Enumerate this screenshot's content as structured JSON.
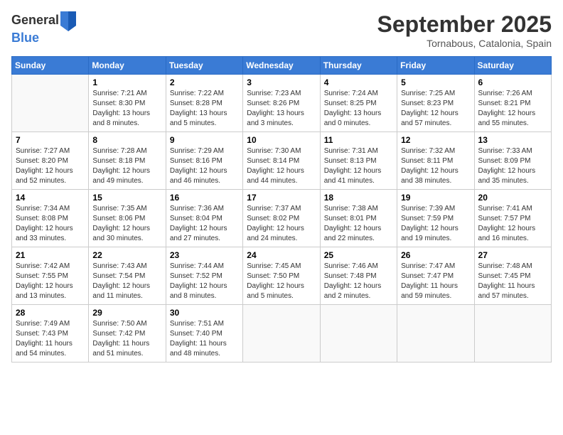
{
  "logo": {
    "general": "General",
    "blue": "Blue"
  },
  "header": {
    "month": "September 2025",
    "location": "Tornabous, Catalonia, Spain"
  },
  "days_of_week": [
    "Sunday",
    "Monday",
    "Tuesday",
    "Wednesday",
    "Thursday",
    "Friday",
    "Saturday"
  ],
  "weeks": [
    [
      {
        "day": "",
        "sunrise": "",
        "sunset": "",
        "daylight": ""
      },
      {
        "day": "1",
        "sunrise": "Sunrise: 7:21 AM",
        "sunset": "Sunset: 8:30 PM",
        "daylight": "Daylight: 13 hours and 8 minutes."
      },
      {
        "day": "2",
        "sunrise": "Sunrise: 7:22 AM",
        "sunset": "Sunset: 8:28 PM",
        "daylight": "Daylight: 13 hours and 5 minutes."
      },
      {
        "day": "3",
        "sunrise": "Sunrise: 7:23 AM",
        "sunset": "Sunset: 8:26 PM",
        "daylight": "Daylight: 13 hours and 3 minutes."
      },
      {
        "day": "4",
        "sunrise": "Sunrise: 7:24 AM",
        "sunset": "Sunset: 8:25 PM",
        "daylight": "Daylight: 13 hours and 0 minutes."
      },
      {
        "day": "5",
        "sunrise": "Sunrise: 7:25 AM",
        "sunset": "Sunset: 8:23 PM",
        "daylight": "Daylight: 12 hours and 57 minutes."
      },
      {
        "day": "6",
        "sunrise": "Sunrise: 7:26 AM",
        "sunset": "Sunset: 8:21 PM",
        "daylight": "Daylight: 12 hours and 55 minutes."
      }
    ],
    [
      {
        "day": "7",
        "sunrise": "Sunrise: 7:27 AM",
        "sunset": "Sunset: 8:20 PM",
        "daylight": "Daylight: 12 hours and 52 minutes."
      },
      {
        "day": "8",
        "sunrise": "Sunrise: 7:28 AM",
        "sunset": "Sunset: 8:18 PM",
        "daylight": "Daylight: 12 hours and 49 minutes."
      },
      {
        "day": "9",
        "sunrise": "Sunrise: 7:29 AM",
        "sunset": "Sunset: 8:16 PM",
        "daylight": "Daylight: 12 hours and 46 minutes."
      },
      {
        "day": "10",
        "sunrise": "Sunrise: 7:30 AM",
        "sunset": "Sunset: 8:14 PM",
        "daylight": "Daylight: 12 hours and 44 minutes."
      },
      {
        "day": "11",
        "sunrise": "Sunrise: 7:31 AM",
        "sunset": "Sunset: 8:13 PM",
        "daylight": "Daylight: 12 hours and 41 minutes."
      },
      {
        "day": "12",
        "sunrise": "Sunrise: 7:32 AM",
        "sunset": "Sunset: 8:11 PM",
        "daylight": "Daylight: 12 hours and 38 minutes."
      },
      {
        "day": "13",
        "sunrise": "Sunrise: 7:33 AM",
        "sunset": "Sunset: 8:09 PM",
        "daylight": "Daylight: 12 hours and 35 minutes."
      }
    ],
    [
      {
        "day": "14",
        "sunrise": "Sunrise: 7:34 AM",
        "sunset": "Sunset: 8:08 PM",
        "daylight": "Daylight: 12 hours and 33 minutes."
      },
      {
        "day": "15",
        "sunrise": "Sunrise: 7:35 AM",
        "sunset": "Sunset: 8:06 PM",
        "daylight": "Daylight: 12 hours and 30 minutes."
      },
      {
        "day": "16",
        "sunrise": "Sunrise: 7:36 AM",
        "sunset": "Sunset: 8:04 PM",
        "daylight": "Daylight: 12 hours and 27 minutes."
      },
      {
        "day": "17",
        "sunrise": "Sunrise: 7:37 AM",
        "sunset": "Sunset: 8:02 PM",
        "daylight": "Daylight: 12 hours and 24 minutes."
      },
      {
        "day": "18",
        "sunrise": "Sunrise: 7:38 AM",
        "sunset": "Sunset: 8:01 PM",
        "daylight": "Daylight: 12 hours and 22 minutes."
      },
      {
        "day": "19",
        "sunrise": "Sunrise: 7:39 AM",
        "sunset": "Sunset: 7:59 PM",
        "daylight": "Daylight: 12 hours and 19 minutes."
      },
      {
        "day": "20",
        "sunrise": "Sunrise: 7:41 AM",
        "sunset": "Sunset: 7:57 PM",
        "daylight": "Daylight: 12 hours and 16 minutes."
      }
    ],
    [
      {
        "day": "21",
        "sunrise": "Sunrise: 7:42 AM",
        "sunset": "Sunset: 7:55 PM",
        "daylight": "Daylight: 12 hours and 13 minutes."
      },
      {
        "day": "22",
        "sunrise": "Sunrise: 7:43 AM",
        "sunset": "Sunset: 7:54 PM",
        "daylight": "Daylight: 12 hours and 11 minutes."
      },
      {
        "day": "23",
        "sunrise": "Sunrise: 7:44 AM",
        "sunset": "Sunset: 7:52 PM",
        "daylight": "Daylight: 12 hours and 8 minutes."
      },
      {
        "day": "24",
        "sunrise": "Sunrise: 7:45 AM",
        "sunset": "Sunset: 7:50 PM",
        "daylight": "Daylight: 12 hours and 5 minutes."
      },
      {
        "day": "25",
        "sunrise": "Sunrise: 7:46 AM",
        "sunset": "Sunset: 7:48 PM",
        "daylight": "Daylight: 12 hours and 2 minutes."
      },
      {
        "day": "26",
        "sunrise": "Sunrise: 7:47 AM",
        "sunset": "Sunset: 7:47 PM",
        "daylight": "Daylight: 11 hours and 59 minutes."
      },
      {
        "day": "27",
        "sunrise": "Sunrise: 7:48 AM",
        "sunset": "Sunset: 7:45 PM",
        "daylight": "Daylight: 11 hours and 57 minutes."
      }
    ],
    [
      {
        "day": "28",
        "sunrise": "Sunrise: 7:49 AM",
        "sunset": "Sunset: 7:43 PM",
        "daylight": "Daylight: 11 hours and 54 minutes."
      },
      {
        "day": "29",
        "sunrise": "Sunrise: 7:50 AM",
        "sunset": "Sunset: 7:42 PM",
        "daylight": "Daylight: 11 hours and 51 minutes."
      },
      {
        "day": "30",
        "sunrise": "Sunrise: 7:51 AM",
        "sunset": "Sunset: 7:40 PM",
        "daylight": "Daylight: 11 hours and 48 minutes."
      },
      {
        "day": "",
        "sunrise": "",
        "sunset": "",
        "daylight": ""
      },
      {
        "day": "",
        "sunrise": "",
        "sunset": "",
        "daylight": ""
      },
      {
        "day": "",
        "sunrise": "",
        "sunset": "",
        "daylight": ""
      },
      {
        "day": "",
        "sunrise": "",
        "sunset": "",
        "daylight": ""
      }
    ]
  ]
}
